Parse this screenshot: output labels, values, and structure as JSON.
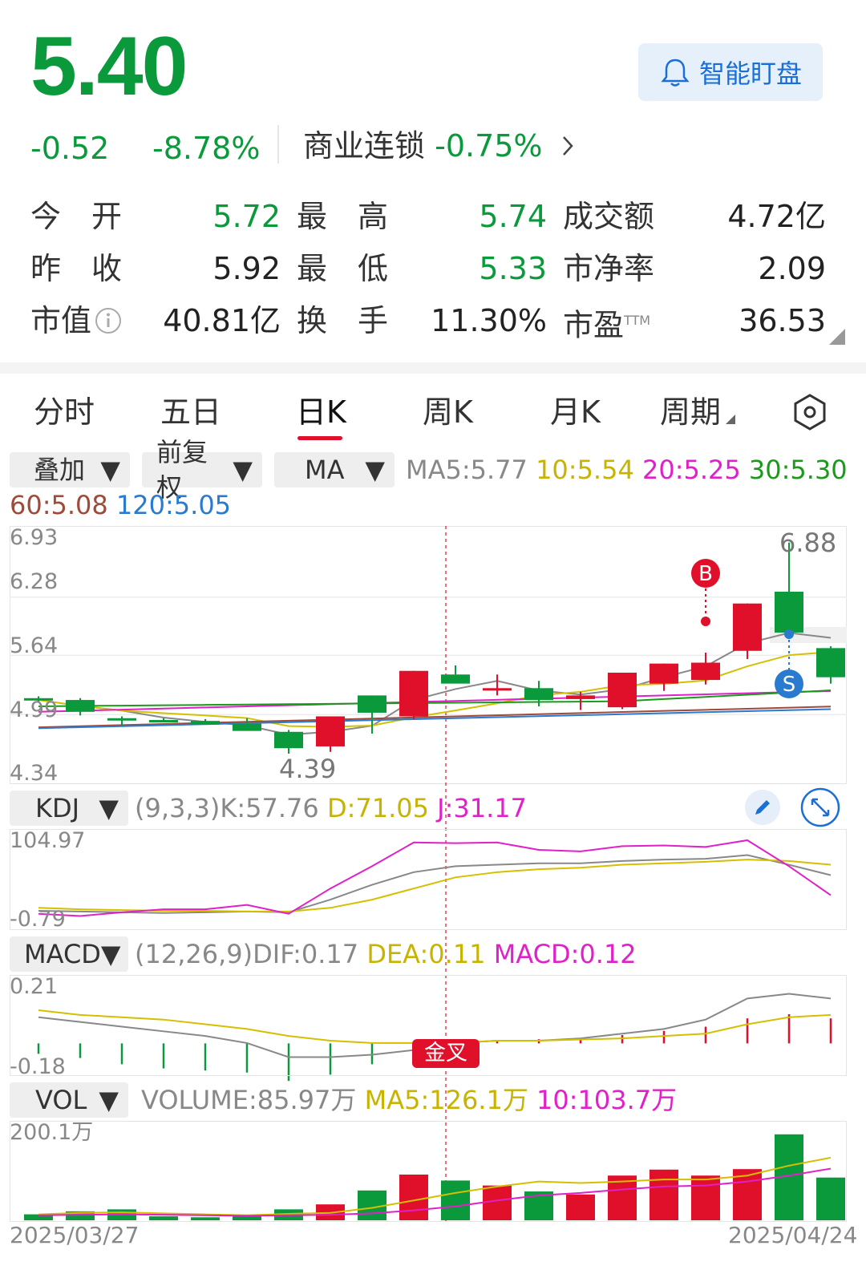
{
  "quote": {
    "price": "5.40",
    "change": "-0.52",
    "change_pct": "-8.78%",
    "sector_name": "商业连锁",
    "sector_pct": "-0.75%",
    "smart_watch_label": "智能盯盘",
    "rows": [
      {
        "l1": "今　开",
        "v1": "5.72",
        "c1": "green",
        "l2": "最　高",
        "v2": "5.74",
        "c2": "green",
        "l3": "成交额",
        "v3": "4.72亿",
        "c3": "dark"
      },
      {
        "l1": "昨　收",
        "v1": "5.92",
        "c1": "dark",
        "l2": "最　低",
        "v2": "5.33",
        "c2": "green",
        "l3": "市净率",
        "v3": "2.09",
        "c3": "dark"
      },
      {
        "l1": "市值",
        "v1": "40.81亿",
        "c1": "dark",
        "l2": "换　手",
        "v2": "11.30%",
        "c2": "dark",
        "l3": "市盈",
        "l3sup": "TTM",
        "v3": "36.53",
        "c3": "dark"
      }
    ]
  },
  "tabs": [
    "分时",
    "五日",
    "日K",
    "周K",
    "月K",
    "周期"
  ],
  "active_tab": "日K",
  "controls": {
    "overlay": "叠加",
    "adjust": "前复权",
    "indicator": "MA"
  },
  "ma_legend": {
    "ma5": "MA5:5.77",
    "ma10": "10:5.54",
    "ma20": "20:5.25",
    "ma30": "30:5.30",
    "ma60": "60:5.08",
    "ma120": "120:5.05"
  },
  "colors": {
    "up": "#e0102a",
    "down": "#0a9a3c",
    "ma5": "#888888",
    "ma10": "#d4c000",
    "ma20": "#e020c8",
    "ma30": "#1a9a1a",
    "ma60": "#a04a3a",
    "ma120": "#2a7ad0"
  },
  "main_chart": {
    "y_labels": [
      "6.93",
      "6.28",
      "5.64",
      "4.99",
      "4.34"
    ],
    "high_marker": "6.88",
    "low_marker": "4.39",
    "buy_marker": "B",
    "sell_marker": "S"
  },
  "kdj": {
    "name": "KDJ",
    "params": "(9,3,3)",
    "k": "K:57.76",
    "d": "D:71.05",
    "j": "J:31.17",
    "y_top": "104.97",
    "y_bottom": "-0.79"
  },
  "macd": {
    "name": "MACD",
    "params": "(12,26,9)",
    "dif": "DIF:0.17",
    "dea": "DEA:0.11",
    "macd": "MACD:0.12",
    "y_top": "0.21",
    "y_bottom": "-0.18",
    "signal": "金叉"
  },
  "vol": {
    "name": "VOL",
    "volume": "VOLUME:85.97万",
    "ma5": "MA5:126.1万",
    "ma10": "10:103.7万",
    "y_top": "200.1万"
  },
  "dates": {
    "start": "2025/03/27",
    "end": "2025/04/24"
  },
  "chart_data": {
    "type": "candlestick",
    "x": [
      "2025/03/27",
      "",
      "",
      "",
      "",
      "",
      "",
      "",
      "",
      "",
      "",
      "",
      "",
      "",
      "",
      "",
      "",
      "",
      "",
      "2025/04/24"
    ],
    "ohlc": [
      [
        5.17,
        5.19,
        5.13,
        5.15
      ],
      [
        5.15,
        5.17,
        4.98,
        5.02
      ],
      [
        4.95,
        4.97,
        4.86,
        4.93
      ],
      [
        4.93,
        4.95,
        4.91,
        4.92
      ],
      [
        4.92,
        4.94,
        4.9,
        4.88
      ],
      [
        4.89,
        4.95,
        4.83,
        4.81
      ],
      [
        4.8,
        4.82,
        4.56,
        4.62
      ],
      [
        4.64,
        4.97,
        4.58,
        4.97
      ],
      [
        5.2,
        5.2,
        4.78,
        5.01
      ],
      [
        4.97,
        5.47,
        4.94,
        5.47
      ],
      [
        5.43,
        5.53,
        5.43,
        5.33
      ],
      [
        5.27,
        5.43,
        5.2,
        5.28
      ],
      [
        5.28,
        5.36,
        5.08,
        5.15
      ],
      [
        5.16,
        5.24,
        5.04,
        5.2
      ],
      [
        5.07,
        5.45,
        5.05,
        5.45
      ],
      [
        5.33,
        5.55,
        5.25,
        5.55
      ],
      [
        5.37,
        5.67,
        5.32,
        5.56
      ],
      [
        5.69,
        6.21,
        5.6,
        6.21
      ],
      [
        6.34,
        6.88,
        5.88,
        5.89
      ],
      [
        5.72,
        5.74,
        5.33,
        5.4
      ]
    ],
    "volume_wan": [
      12,
      18,
      22,
      8,
      6,
      8,
      22,
      32,
      60,
      92,
      80,
      70,
      58,
      52,
      90,
      102,
      90,
      103,
      173,
      86
    ],
    "ylim": [
      4.34,
      6.93
    ]
  }
}
